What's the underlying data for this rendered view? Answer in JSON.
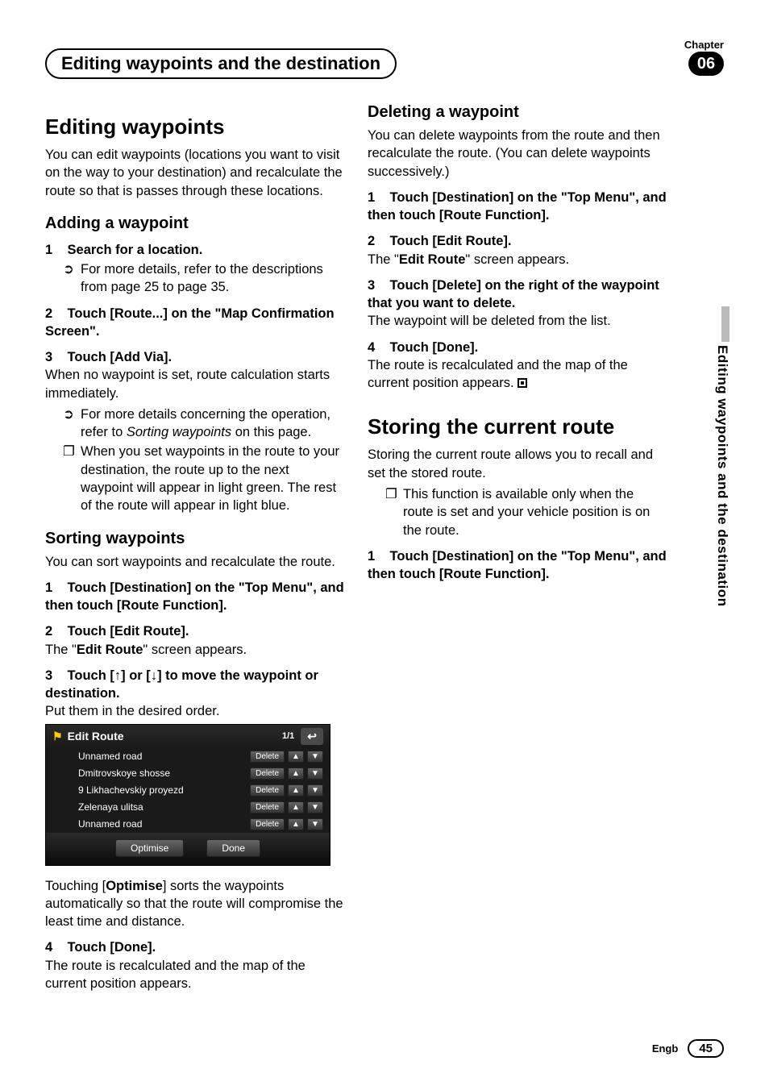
{
  "chapter": {
    "label": "Chapter",
    "number": "06"
  },
  "header": {
    "title": "Editing waypoints and the destination"
  },
  "sideTab": "Editing waypoints and the destination",
  "footer": {
    "lang": "Engb",
    "page": "45"
  },
  "col1": {
    "h2_1": "Editing waypoints",
    "p1": "You can edit waypoints (locations you want to visit on the way to your destination) and recalculate the route so that is passes through these locations.",
    "h3_1": "Adding a waypoint",
    "s1": {
      "num": "1",
      "text": "Search for a location."
    },
    "s1_sub_pre": "For more details, refer to the descriptions from page 25 to page 35.",
    "s2": {
      "num": "2",
      "text": "Touch [Route...] on the \"Map Confirmation Screen\"."
    },
    "s3": {
      "num": "3",
      "text": "Touch [Add Via]."
    },
    "s3_p": "When no waypoint is set, route calculation starts immediately.",
    "s3_sub1_pre": "For more details concerning the operation, refer to ",
    "s3_sub1_italic": "Sorting waypoints",
    "s3_sub1_post": " on this page.",
    "s3_sub2": "When you set waypoints in the route to your destination, the route up to the next waypoint will appear in light green. The rest of the route will appear in light blue.",
    "h3_2": "Sorting waypoints",
    "p2": "You can sort waypoints and recalculate the route.",
    "s4": {
      "num": "1",
      "text": "Touch [Destination] on the \"Top Menu\", and then touch [Route Function]."
    },
    "s5": {
      "num": "2",
      "text": "Touch [Edit Route]."
    },
    "s5_p_pre": "The \"",
    "s5_p_bold": "Edit Route",
    "s5_p_post": "\" screen appears.",
    "s6": {
      "num": "3",
      "pre": "Touch [",
      "mid": "] or [",
      "post": "] to move the waypoint or destination."
    },
    "s6_p": "Put them in the desired order."
  },
  "ui": {
    "title": "Edit Route",
    "pageInd": "1/1",
    "back": "↩",
    "rows": [
      {
        "name": "Unnamed road",
        "del": "Delete"
      },
      {
        "name": "Dmitrovskoye shosse",
        "del": "Delete"
      },
      {
        "name": "9 Likhachevskiy proyezd",
        "del": "Delete"
      },
      {
        "name": "Zelenaya ulitsa",
        "del": "Delete"
      },
      {
        "name": "Unnamed road",
        "del": "Delete"
      }
    ],
    "optimise": "Optimise",
    "done": "Done"
  },
  "col2": {
    "opt_pre": "Touching [",
    "opt_bold": "Optimise",
    "opt_post": "] sorts the waypoints automatically so that the route will compromise the least time  and distance.",
    "s7": {
      "num": "4",
      "text": "Touch [Done]."
    },
    "s7_p": "The route is recalculated and the map of the current position appears.",
    "h3_3": "Deleting a waypoint",
    "p3": "You can delete waypoints from the route and then recalculate the route. (You can delete waypoints successively.)",
    "s8": {
      "num": "1",
      "text": "Touch [Destination] on the \"Top Menu\", and then touch [Route Function]."
    },
    "s9": {
      "num": "2",
      "text": "Touch [Edit Route]."
    },
    "s9_p_pre": "The \"",
    "s9_p_bold": "Edit Route",
    "s9_p_post": "\" screen appears.",
    "s10": {
      "num": "3",
      "text": "Touch [Delete] on the right of the waypoint that you want to delete."
    },
    "s10_p": "The waypoint will be deleted from the list.",
    "s11": {
      "num": "4",
      "text": "Touch [Done]."
    },
    "s11_p": "The route is recalculated and the map of the current position appears.",
    "h2_2": "Storing the current route",
    "p4": "Storing the current route allows you to recall and set the stored route.",
    "p4_sub": "This function is available only when the route is set and your vehicle position is on the route.",
    "s12": {
      "num": "1",
      "text": "Touch [Destination] on the \"Top Menu\", and then touch [Route Function]."
    }
  }
}
